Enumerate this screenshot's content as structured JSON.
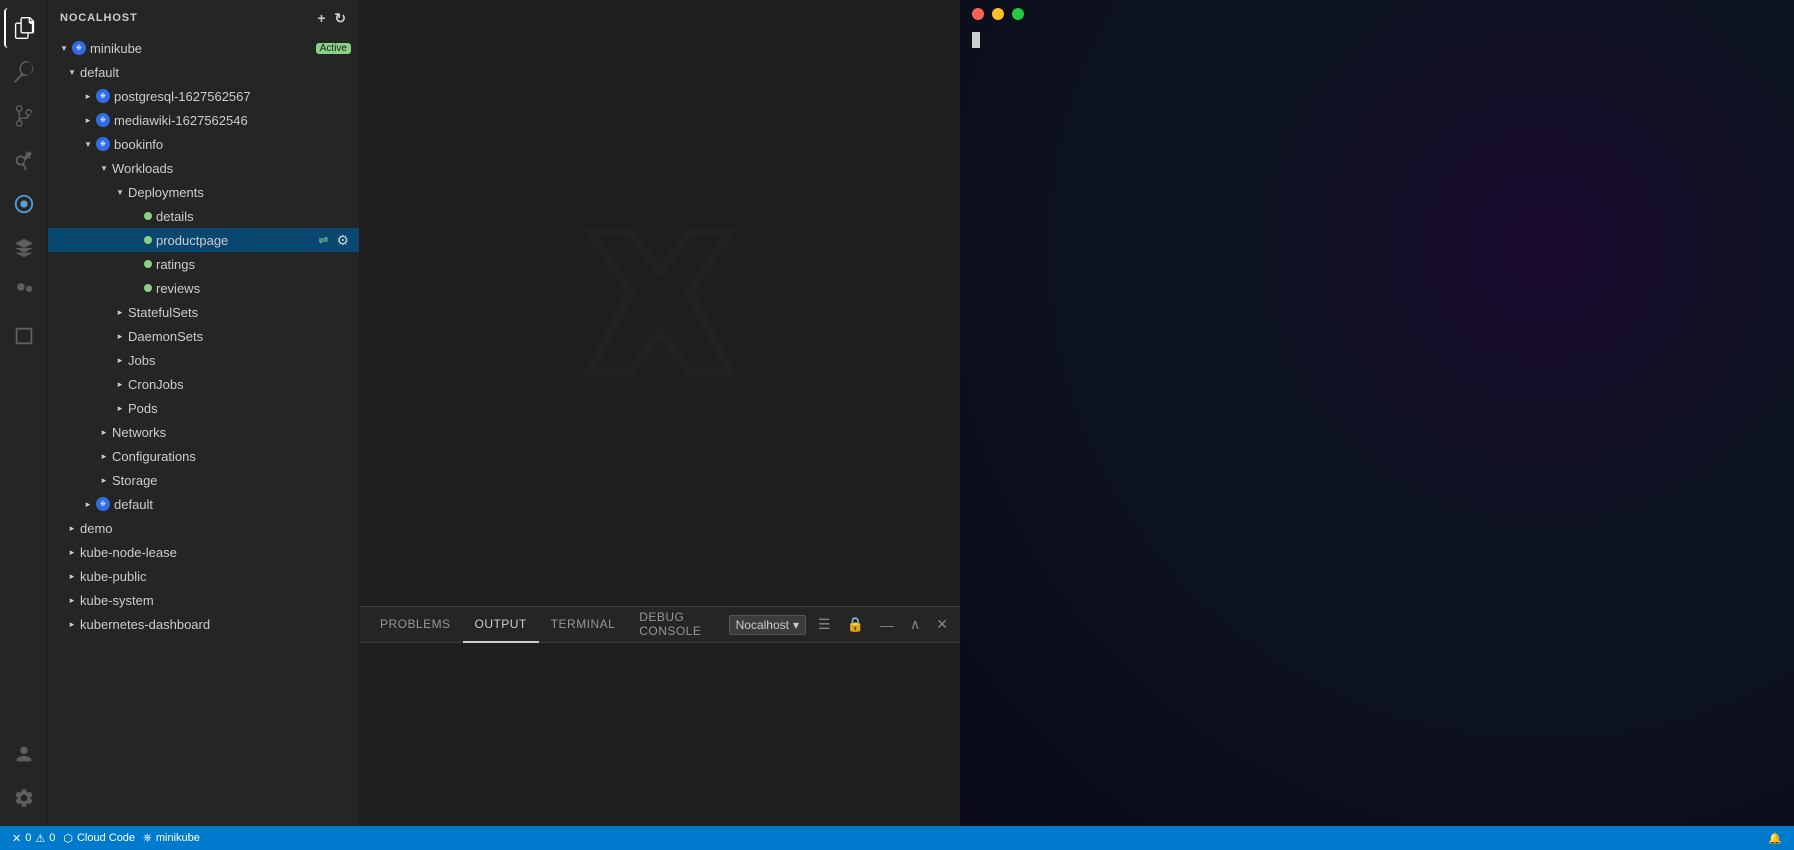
{
  "app": {
    "title": "NOCALHOST"
  },
  "statusBar": {
    "errors": "0",
    "warnings": "0",
    "cloudCode": "Cloud Code",
    "cluster": "minikube",
    "errorIcon": "✕",
    "warningIcon": "⚠"
  },
  "panel": {
    "tabs": [
      "PROBLEMS",
      "OUTPUT",
      "TERMINAL",
      "DEBUG CONSOLE"
    ],
    "activeTab": "OUTPUT",
    "dropdown": "Nocalhost"
  },
  "sidebar": {
    "header": "NOCALHOST",
    "tree": [
      {
        "id": "minikube",
        "label": "minikube",
        "badge": "Active",
        "depth": 0,
        "type": "cluster",
        "open": true
      },
      {
        "id": "default",
        "label": "default",
        "depth": 1,
        "type": "namespace",
        "open": true
      },
      {
        "id": "postgresql",
        "label": "postgresql-1627562567",
        "depth": 2,
        "type": "workload-icon",
        "open": false
      },
      {
        "id": "mediawiki",
        "label": "mediawiki-1627562546",
        "depth": 2,
        "type": "workload-icon",
        "open": false
      },
      {
        "id": "bookinfo",
        "label": "bookinfo",
        "depth": 2,
        "type": "workload-icon",
        "open": true
      },
      {
        "id": "workloads",
        "label": "Workloads",
        "depth": 3,
        "type": "folder",
        "open": true
      },
      {
        "id": "deployments",
        "label": "Deployments",
        "depth": 4,
        "type": "folder",
        "open": true
      },
      {
        "id": "details",
        "label": "details",
        "depth": 5,
        "type": "deployment-dot"
      },
      {
        "id": "productpage",
        "label": "productpage",
        "depth": 5,
        "type": "deployment-dot",
        "selected": true,
        "hasActions": true
      },
      {
        "id": "ratings",
        "label": "ratings",
        "depth": 5,
        "type": "deployment-dot"
      },
      {
        "id": "reviews",
        "label": "reviews",
        "depth": 5,
        "type": "deployment-dot"
      },
      {
        "id": "statefulsets",
        "label": "StatefulSets",
        "depth": 4,
        "type": "folder",
        "open": false
      },
      {
        "id": "daemonsets",
        "label": "DaemonSets",
        "depth": 4,
        "type": "folder",
        "open": false
      },
      {
        "id": "jobs",
        "label": "Jobs",
        "depth": 4,
        "type": "folder",
        "open": false
      },
      {
        "id": "cronjobs",
        "label": "CronJobs",
        "depth": 4,
        "type": "folder",
        "open": false
      },
      {
        "id": "pods",
        "label": "Pods",
        "depth": 4,
        "type": "folder",
        "open": false
      },
      {
        "id": "networks",
        "label": "Networks",
        "depth": 3,
        "type": "folder",
        "open": false
      },
      {
        "id": "configurations",
        "label": "Configurations",
        "depth": 3,
        "type": "folder",
        "open": false
      },
      {
        "id": "storage",
        "label": "Storage",
        "depth": 3,
        "type": "folder",
        "open": false
      },
      {
        "id": "default2",
        "label": "default",
        "depth": 2,
        "type": "workload-icon",
        "open": false
      },
      {
        "id": "demo",
        "label": "demo",
        "depth": 1,
        "type": "namespace-closed"
      },
      {
        "id": "kube-node-lease",
        "label": "kube-node-lease",
        "depth": 1,
        "type": "namespace-closed"
      },
      {
        "id": "kube-public",
        "label": "kube-public",
        "depth": 1,
        "type": "namespace-closed"
      },
      {
        "id": "kube-system",
        "label": "kube-system",
        "depth": 1,
        "type": "namespace-closed"
      },
      {
        "id": "kubernetes-dashboard",
        "label": "kubernetes-dashboard",
        "depth": 1,
        "type": "namespace-closed"
      }
    ]
  }
}
